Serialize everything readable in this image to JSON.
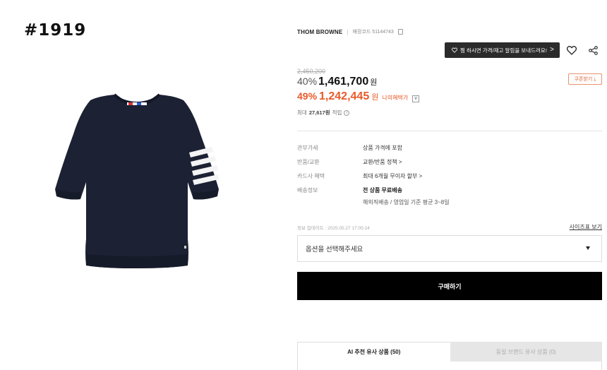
{
  "overlay": {
    "label": "#1919"
  },
  "product": {
    "brand": "THOM BROWNE",
    "code": "매장코드 51144743",
    "image_alt": "navy short sleeve knit with four white stripes"
  },
  "actions": {
    "notify_label": "찜 하시면 가격/재고 알림을 보내드려요!",
    "notify_arrow": ">",
    "heart_icon": "heart-icon",
    "share_icon": "share-icon"
  },
  "pricing": {
    "original": "2,450,200",
    "discount": "40%",
    "price": "1,461,700",
    "currency": "원",
    "coupon_label": "쿠폰받기 ⤓",
    "benefit_discount": "49%",
    "benefit_price": "1,242,445",
    "benefit_currency": "원",
    "benefit_label": "나의혜택가",
    "benefit_toggle": "v",
    "points_prefix": "최대",
    "points_value": "27,617원",
    "points_suffix": "적립",
    "info_icon": "i"
  },
  "info": [
    {
      "label": "관부가세",
      "value": "상품 가격에 포함"
    },
    {
      "label": "반품/교환",
      "value": "교환/반품 정책 >"
    },
    {
      "label": "카드사 혜택",
      "value": "최대 6개월 무이자 할부 >"
    },
    {
      "label": "배송정보",
      "value": "전 상품 무료배송",
      "sub": "해외직배송 / 영업일 기준 평균 3~8일"
    }
  ],
  "update": {
    "time": "정보 업데이트 : 2025.05.27 17:05:24",
    "size_guide": "사이즈표 보기"
  },
  "option": {
    "placeholder": "옵션을 선택해주세요"
  },
  "buy": {
    "label": "구매하기"
  },
  "tabs": [
    {
      "label": "AI 추천 유사 상품 (50)",
      "active": true
    },
    {
      "label": "동일 브랜드 유사 상품 (0)",
      "active": false
    }
  ],
  "colors": {
    "accent": "#e85a2a",
    "notify_bg": "#2b2b2b",
    "buy_bg": "#000000",
    "shirt": "#1c2233"
  }
}
